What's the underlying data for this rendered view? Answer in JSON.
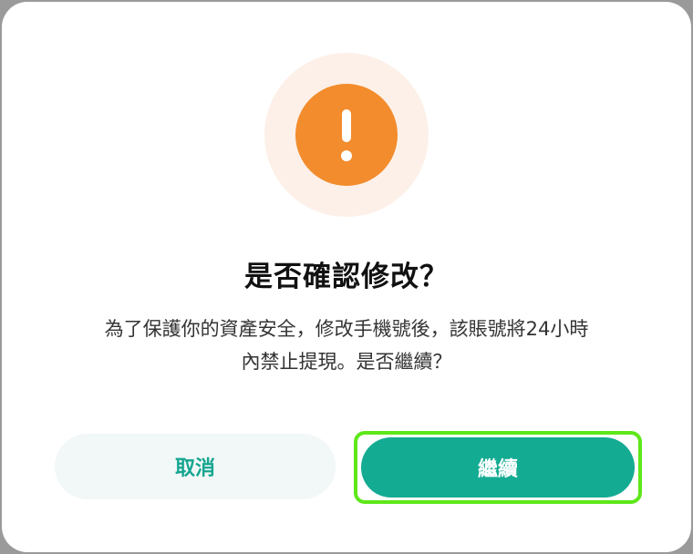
{
  "dialog": {
    "icon": "exclamation-warning-icon",
    "title": "是否確認修改？",
    "message_line1": "為了保護你的資產安全，修改手機號後，該賬號將24小時",
    "message_line2": "內禁止提現。是否繼續？",
    "cancel_label": "取消",
    "continue_label": "繼續"
  },
  "colors": {
    "accent": "#14ab93",
    "warning": "#f28c2c",
    "warning_halo": "#fdf0e8",
    "highlight": "#5ee81a"
  }
}
